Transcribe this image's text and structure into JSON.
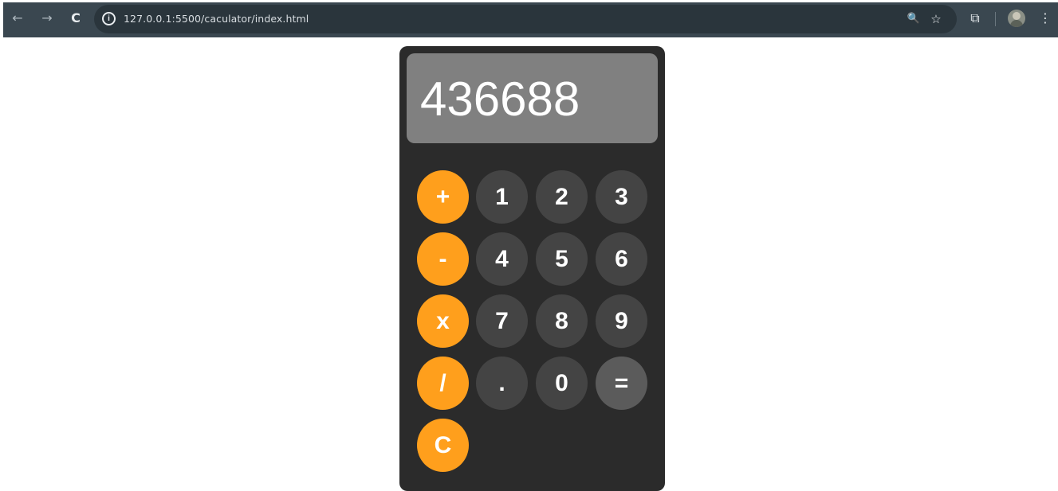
{
  "browser": {
    "url": "127.0.0.1:5500/caculator/index.html",
    "icons": {
      "back": "back-arrow-icon",
      "forward": "forward-arrow-icon",
      "reload": "reload-icon",
      "info": "info-icon",
      "zoom": "zoom-icon",
      "bookmark": "star-icon",
      "extensions": "extensions-icon",
      "profile": "avatar-icon",
      "menu": "kebab-menu-icon"
    },
    "glyphs": {
      "back": "←",
      "forward": "→",
      "reload": "C",
      "info": "i",
      "zoom": "🔍",
      "bookmark": "☆",
      "extensions": "⧉",
      "menu": "⋮"
    }
  },
  "calculator": {
    "display_value": "436688",
    "keys": {
      "plus": "+",
      "minus": "-",
      "multiply": "x",
      "divide": "/",
      "clear": "C",
      "one": "1",
      "two": "2",
      "three": "3",
      "four": "4",
      "five": "5",
      "six": "6",
      "seven": "7",
      "eight": "8",
      "nine": "9",
      "dot": ".",
      "zero": "0",
      "equals": "="
    },
    "colors": {
      "body": "#2b2b2b",
      "display": "#808080",
      "operator": "#ff9f1c",
      "number": "#444444",
      "equals": "#5b5b5b"
    }
  }
}
